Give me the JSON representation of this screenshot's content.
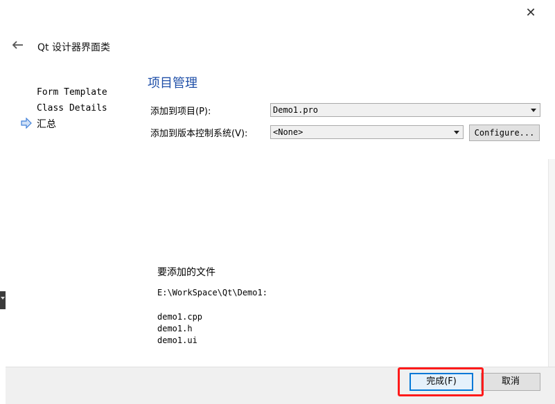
{
  "window": {
    "title": "Qt 设计器界面类",
    "close_glyph": "✕",
    "back_glyph": "🡐"
  },
  "steps": [
    {
      "label": "Form Template",
      "current": false
    },
    {
      "label": "Class Details",
      "current": false
    },
    {
      "label": "汇总",
      "current": true
    }
  ],
  "page": {
    "title": "项目管理",
    "add_to_project_label": "添加到项目(P):",
    "add_to_project_value": "Demo1.pro",
    "add_to_vcs_label": "添加到版本控制系统(V):",
    "add_to_vcs_value": "<None>",
    "configure_label": "Configure..."
  },
  "files": {
    "heading": "要添加的文件",
    "path": "E:\\WorkSpace\\Qt\\Demo1:",
    "items": [
      "demo1.cpp",
      "demo1.h",
      "demo1.ui"
    ]
  },
  "buttons": {
    "finish_label": "完成(F)",
    "cancel_label": "取消"
  },
  "colors": {
    "accent": "#0078d7",
    "title": "#1f4fa8",
    "highlight": "#ff1a1a"
  }
}
